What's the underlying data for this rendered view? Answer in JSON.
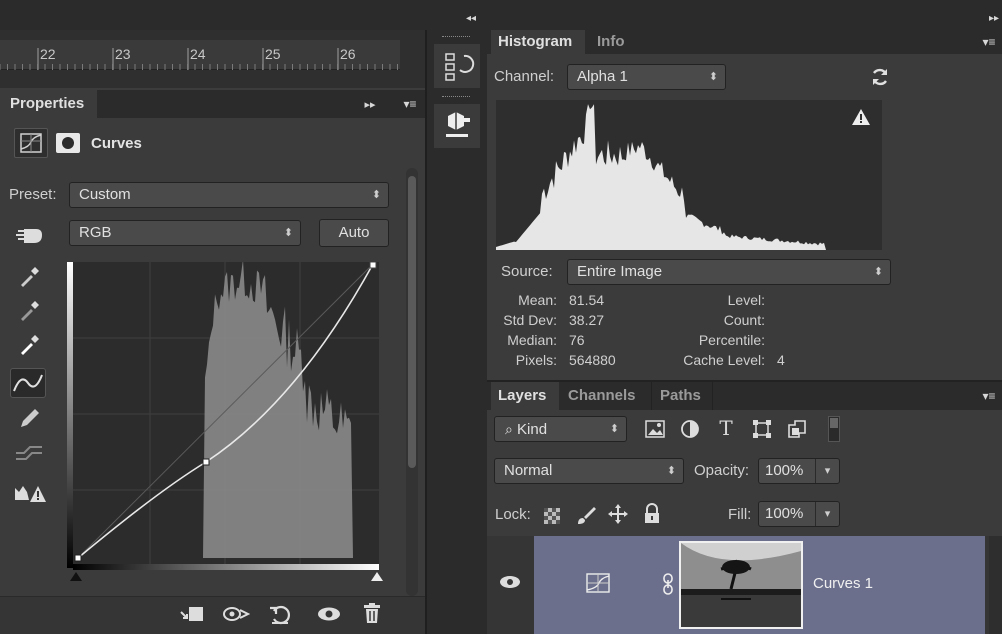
{
  "ruler": {
    "ticks": [
      "22",
      "23",
      "24",
      "25",
      "26"
    ]
  },
  "properties": {
    "tab_label": "Properties",
    "mode_label": "Curves",
    "preset_label": "Preset:",
    "preset_value": "Custom",
    "channel_value": "RGB",
    "auto_label": "Auto"
  },
  "histogram": {
    "tab_histogram": "Histogram",
    "tab_info": "Info",
    "channel_label": "Channel:",
    "channel_value": "Alpha 1",
    "source_label": "Source:",
    "source_value": "Entire Image",
    "stats": {
      "mean_label": "Mean:",
      "mean_value": "81.54",
      "std_label": "Std Dev:",
      "std_value": "38.27",
      "median_label": "Median:",
      "median_value": "76",
      "pixels_label": "Pixels:",
      "pixels_value": "564880",
      "level_label": "Level:",
      "level_value": "",
      "count_label": "Count:",
      "count_value": "",
      "percentile_label": "Percentile:",
      "percentile_value": "",
      "cache_label": "Cache Level:",
      "cache_value": "4"
    }
  },
  "layers": {
    "tab_layers": "Layers",
    "tab_channels": "Channels",
    "tab_paths": "Paths",
    "kind_value": "Kind",
    "blend_value": "Normal",
    "opacity_label": "Opacity:",
    "opacity_value": "100%",
    "lock_label": "Lock:",
    "fill_label": "Fill:",
    "fill_value": "100%",
    "layer_name": "Curves 1"
  },
  "colors": {
    "panel_bg": "#3b3b3b",
    "dark_bg": "#2b2b2b",
    "selected_layer": "#6b6f8c"
  }
}
